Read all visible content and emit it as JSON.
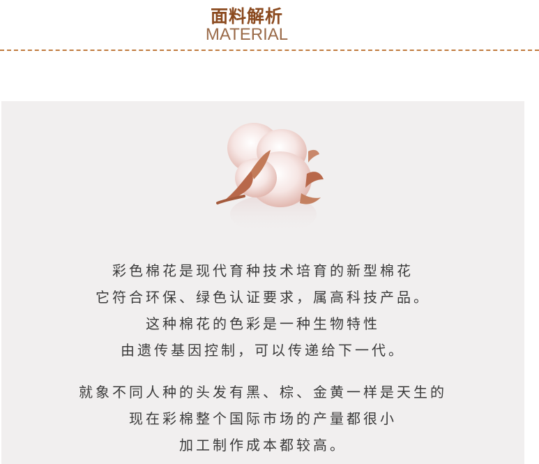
{
  "header": {
    "title_cn": "面料解析",
    "title_en": "MATERIAL"
  },
  "colors": {
    "title": "#8b4a1f",
    "accent_dash": "#c07a3e",
    "panel_bg": "#f1efef",
    "body_text": "#3a3a3a"
  },
  "content": {
    "image_icon": "cotton-boll-icon",
    "paragraph1": [
      "彩色棉花是现代育种技术培育的新型棉花",
      "它符合环保、绿色认证要求，属高科技产品。",
      "这种棉花的色彩是一种生物特性",
      "由遗传基因控制，可以传递给下一代。"
    ],
    "paragraph2": [
      "就象不同人种的头发有黑、棕、金黄一样是天生的",
      "现在彩棉整个国际市场的产量都很小",
      "加工制作成本都较高。"
    ]
  }
}
